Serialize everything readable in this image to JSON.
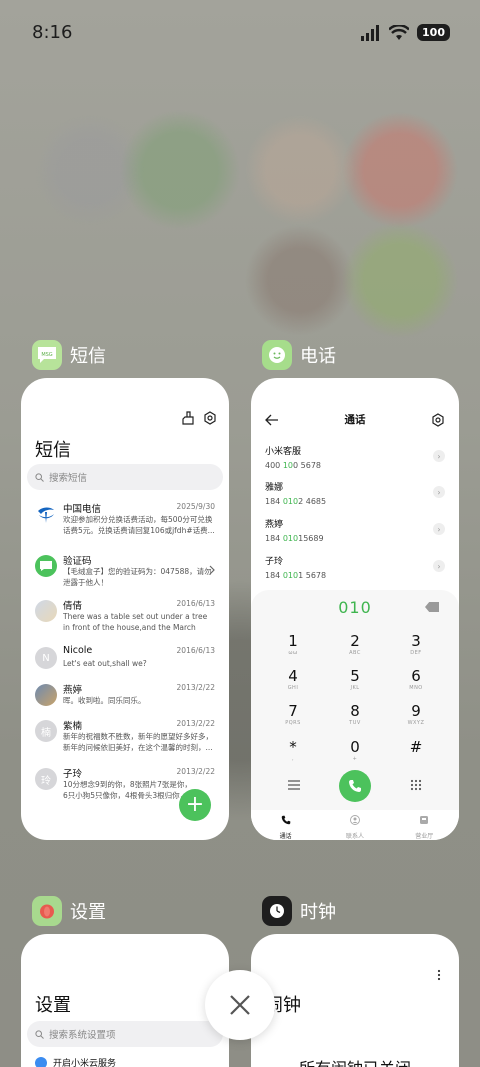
{
  "status_bar": {
    "time": "8:16",
    "battery": "100"
  },
  "apps": {
    "sms": {
      "label": "短信",
      "title": "短信",
      "search_placeholder": "搜索短信",
      "messages": [
        {
          "name": "中国电信",
          "date": "2025/9/30",
          "text": "欢迎参加积分兑换话费活动，每500分可兑换话费5元。兑换话费请回复106或jfdh#话费..."
        },
        {
          "name": "验证码",
          "date": "",
          "text": "【毛绒盒子】您的验证码为：047588，请勿泄露于他人！"
        },
        {
          "name": "倩倩",
          "date": "2016/6/13",
          "text": "There was a table set out under a tree in front of the house,and the March Hare an..."
        },
        {
          "name": "Nicole",
          "date": "2016/6/13",
          "text": "Let's eat out,shall we?"
        },
        {
          "name": "燕婷",
          "date": "2013/2/22",
          "text": "晖。收到啦。同乐同乐。"
        },
        {
          "name": "紫楠",
          "date": "2013/2/22",
          "text": "新年的祝福数不胜数，新年的愿望好多好多，新年的问候依旧美好，在这个温馨的时刻，..."
        },
        {
          "name": "子玲",
          "date": "2013/2/22",
          "text": "10分想念9到的你，8张照片7张是你，6只小狗5只像你，4根骨头3根归你，2爪子1只..."
        }
      ],
      "avatar_letters": {
        "nicole": "N",
        "zinan": "楠",
        "ziling": "玲"
      },
      "fab_label": "+"
    },
    "phone": {
      "label": "电话",
      "title": "通话",
      "contacts": [
        {
          "name": "小米客服",
          "num_pre": "400 ",
          "num_hl": "10",
          "num_mid": "0",
          "num_post": " 5678"
        },
        {
          "name": "雅娜",
          "num_pre": "184 ",
          "num_hl": "010",
          "num_mid": "2",
          "num_post": " 4685"
        },
        {
          "name": "燕婷",
          "num_pre": "184 ",
          "num_hl": "010",
          "num_mid": "1",
          "num_post": "5689"
        },
        {
          "name": "子玲",
          "num_pre": "184 ",
          "num_hl": "010",
          "num_mid": "1",
          "num_post": " 5678"
        }
      ],
      "dial_input": "010",
      "keys": [
        {
          "d": "1",
          "l": "ωω"
        },
        {
          "d": "2",
          "l": "ABC"
        },
        {
          "d": "3",
          "l": "DEF"
        },
        {
          "d": "4",
          "l": "GHI"
        },
        {
          "d": "5",
          "l": "JKL"
        },
        {
          "d": "6",
          "l": "MNO"
        },
        {
          "d": "7",
          "l": "PQRS"
        },
        {
          "d": "8",
          "l": "TUV"
        },
        {
          "d": "9",
          "l": "WXYZ"
        },
        {
          "d": "*",
          "l": ","
        },
        {
          "d": "0",
          "l": "+"
        },
        {
          "d": "#",
          "l": ""
        }
      ],
      "nav": {
        "calls": "通话",
        "contacts": "联系人",
        "business": "营业厅"
      }
    },
    "settings": {
      "label": "设置",
      "title": "设置",
      "search_placeholder": "搜索系统设置项",
      "first_item": "开启小米云服务"
    },
    "clock": {
      "label": "时钟",
      "title": "闹钟",
      "status": "所有闹钟已关闭"
    }
  },
  "colors": {
    "accent_green": "#4cc25c"
  }
}
